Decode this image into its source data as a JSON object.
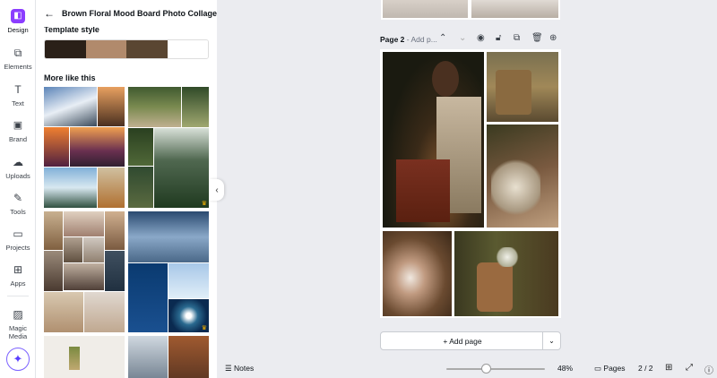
{
  "rail": {
    "items": [
      {
        "label": "Design",
        "icon": "design-icon",
        "glyph": "◧"
      },
      {
        "label": "Elements",
        "icon": "elements-icon",
        "glyph": "⧉"
      },
      {
        "label": "Text",
        "icon": "text-icon",
        "glyph": "T"
      },
      {
        "label": "Brand",
        "icon": "brand-icon",
        "glyph": "▣"
      },
      {
        "label": "Uploads",
        "icon": "uploads-icon",
        "glyph": "☁"
      },
      {
        "label": "Tools",
        "icon": "tools-icon",
        "glyph": "✎"
      },
      {
        "label": "Projects",
        "icon": "projects-icon",
        "glyph": "▭"
      },
      {
        "label": "Apps",
        "icon": "apps-icon",
        "glyph": "⊞"
      },
      {
        "label": "Magic Media",
        "icon": "magic-media-icon",
        "glyph": "▨"
      }
    ],
    "magic_glyph": "✦"
  },
  "panel": {
    "back_glyph": "←",
    "title": "Brown Floral Mood Board Photo Collage",
    "template_style_heading": "Template style",
    "swatches": [
      "#2a2018",
      "#b18a6c",
      "#5a4632",
      "#ffffff"
    ],
    "more_like_heading": "More like this",
    "premium_glyph": "♛",
    "collapse_glyph": "‹"
  },
  "canvas": {
    "page_label": "Page 2",
    "page_title_placeholder": "- Add p...",
    "page_tools": [
      "chevron-up-icon",
      "chevron-down-icon",
      "eye-icon",
      "lock-icon",
      "duplicate-icon",
      "trash-icon",
      "add-page-icon"
    ],
    "add_page_label": "+ Add page",
    "add_page_chevron": "⌄"
  },
  "bottombar": {
    "notes_label": "Notes",
    "zoom": "48%",
    "zoom_fraction": 0.35,
    "pages_label": "Pages",
    "page_count": "2 / 2"
  },
  "colors": {
    "accent": "#8b3dff",
    "canvas_bg": "#ebecf0"
  }
}
